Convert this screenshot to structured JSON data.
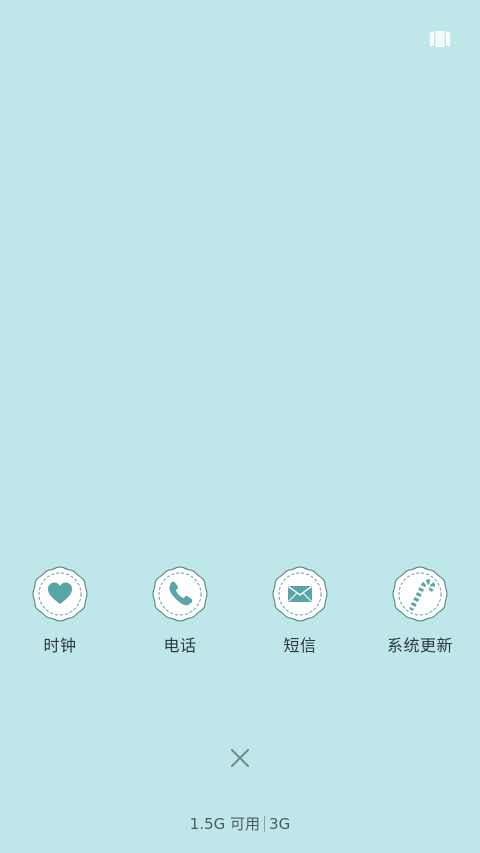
{
  "background_color": "#bfe7e9",
  "accent_color": "#5aa5a8",
  "top_right": {
    "icon": "recent-apps-grid-icon"
  },
  "apps": [
    {
      "label": "时钟",
      "icon": "heart-icon"
    },
    {
      "label": "电话",
      "icon": "phone-icon"
    },
    {
      "label": "短信",
      "icon": "envelope-icon"
    },
    {
      "label": "系统更新",
      "icon": "candy-cane-icon"
    }
  ],
  "close": {
    "icon": "close-icon"
  },
  "memory": {
    "available": "1.5G 可用",
    "network": "3G"
  }
}
